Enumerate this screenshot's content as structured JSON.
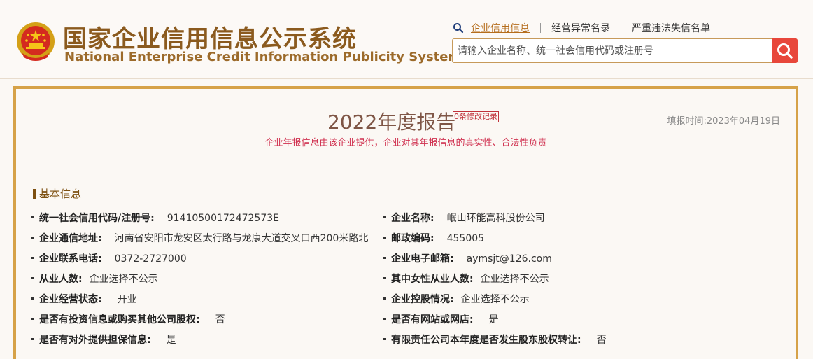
{
  "header": {
    "title_cn": "国家企业信用信息公示系统",
    "title_en": "National Enterprise Credit Information Publicity System",
    "nav": [
      "企业信用信息",
      "经营异常名录",
      "严重违法失信名单"
    ],
    "search_placeholder": "请输入企业名称、统一社会信用代码或注册号"
  },
  "report": {
    "title": "2022年度报告",
    "revision_link": "0条修改记录",
    "fill_time": "填报时间:2023年04月19日",
    "disclaimer": "企业年报信息由该企业提供，企业对其年报信息的真实性、合法性负责"
  },
  "basic_info": {
    "section_title": "基本信息",
    "rows": [
      {
        "left_label": "统一社会信用代码/注册号:",
        "left_value": "91410500172472573E",
        "right_label": "企业名称:",
        "right_value": "岷山环能高科股份公司"
      },
      {
        "left_label": "企业通信地址:",
        "left_value": "河南省安阳市龙安区太行路与龙康大道交叉口西200米路北",
        "right_label": "邮政编码:",
        "right_value": "455005"
      },
      {
        "left_label": "企业联系电话:",
        "left_value": "0372-2727000",
        "right_label": "企业电子邮箱:",
        "right_value": "aymsjt@126.com"
      },
      {
        "left_label": "从业人数:",
        "left_value": "企业选择不公示",
        "right_label": "其中女性从业人数:",
        "right_value": "企业选择不公示"
      },
      {
        "left_label": "企业经营状态:",
        "left_value": "开业",
        "right_label": "企业控股情况:",
        "right_value": "企业选择不公示"
      },
      {
        "left_label": "是否有投资信息或购买其他公司股权:",
        "left_value": "否",
        "right_label": "是否有网站或网店:",
        "right_value": "是"
      },
      {
        "left_label": "是否有对外提供担保信息:",
        "left_value": "是",
        "right_label": "有限责任公司本年度是否发生股东股权转让:",
        "right_value": "否"
      }
    ]
  },
  "colors": {
    "brand": "#8b5a1e",
    "accent_border": "#d6a248",
    "search_button": "#e8473b",
    "disclaimer": "#d0304f"
  },
  "icons": [
    "national-emblem-icon",
    "search-icon",
    "search-button-icon"
  ]
}
